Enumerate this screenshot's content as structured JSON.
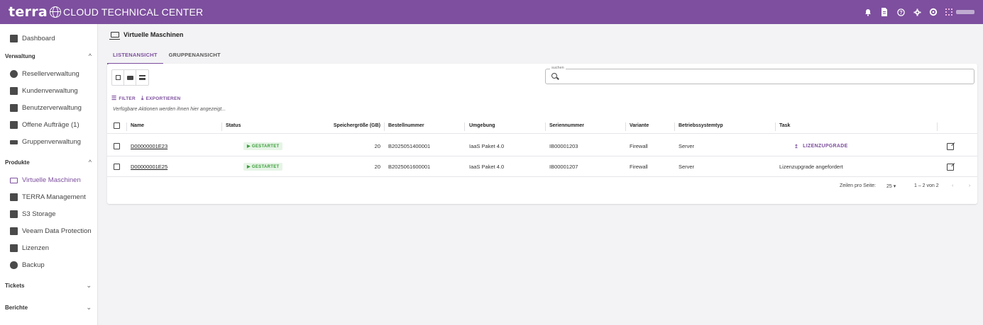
{
  "header": {
    "brand": "terra",
    "subtitle": "CLOUD TECHNICAL CENTER",
    "icons": [
      "bell-icon",
      "document-icon",
      "help-icon",
      "settings-icon",
      "gear-icon",
      "qr-icon"
    ]
  },
  "sidebar": {
    "dashboard": "Dashboard",
    "sections": {
      "verwaltung": "Verwaltung",
      "produkte": "Produkte",
      "tickets": "Tickets",
      "berichte": "Berichte"
    },
    "verwaltung_items": [
      "Resellerverwaltung",
      "Kundenverwaltung",
      "Benutzerverwaltung",
      "Offene Aufträge (1)",
      "Gruppenverwaltung"
    ],
    "produkte_items": [
      "Virtuelle Maschinen",
      "TERRA Management",
      "S3 Storage",
      "Veeam Data Protection",
      "Lizenzen",
      "Backup"
    ]
  },
  "main": {
    "title": "Virtuelle Maschinen",
    "tabs": [
      "LISTENANSICHT",
      "GRUPPENANSICHT"
    ],
    "search_label": "suchen",
    "search_value": "",
    "filter_label": "FILTER",
    "export_label": "EXPORTIEREN",
    "hint": "Verfügbare Aktionen werden ihnen hier angezeigt..."
  },
  "table": {
    "columns": [
      "Name",
      "Status",
      "Speichergröße (GB)",
      "Bestellnummer",
      "Umgebung",
      "Seriennummer",
      "Variante",
      "Betriebssystemtyp",
      "Task"
    ],
    "rows": [
      {
        "name": "D00000001E23",
        "status": "▶ GESTARTET",
        "storage": "20",
        "order": "B2025051400001",
        "environment": "IaaS Paket 4.0",
        "serial": "IB00001203",
        "variant": "Firewall",
        "os": "Server",
        "task": "LIZENZUPGRADE",
        "task_icon": "↥"
      },
      {
        "name": "D00000001E25",
        "status": "▶ GESTARTET",
        "storage": "20",
        "order": "B2025061600001",
        "environment": "IaaS Paket 4.0",
        "serial": "IB00001207",
        "variant": "Firewall",
        "os": "Server",
        "task": "Lizenzupgrade angefordert",
        "task_icon": ""
      }
    ]
  },
  "pagination": {
    "rows_per_page_label": "Zeilen pro Seite:",
    "rows_per_page": "25",
    "range": "1 – 2 von 2"
  },
  "colors": {
    "brand": "#7d4f9e",
    "status_green": "#3b9d3b"
  }
}
